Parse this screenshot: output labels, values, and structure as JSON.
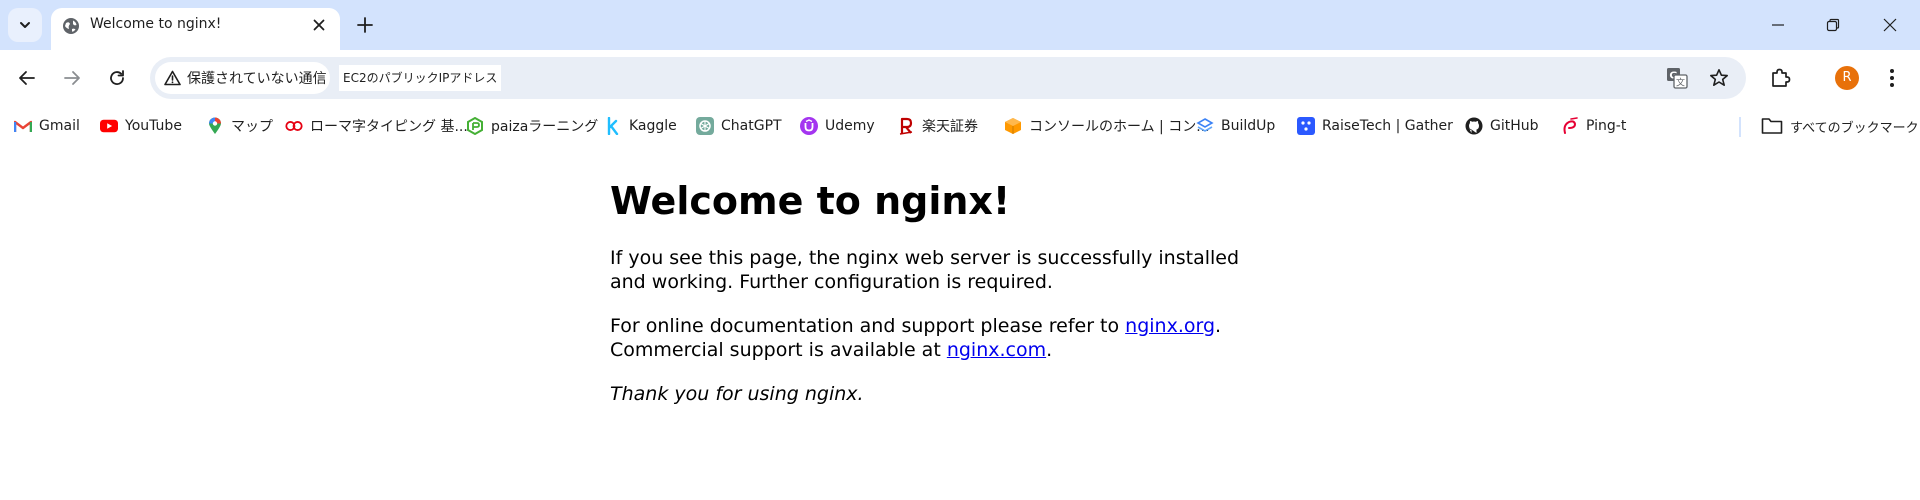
{
  "browser": {
    "tab": {
      "title": "Welcome to nginx!"
    },
    "address": {
      "security_label": "保護されていない通信",
      "url": "EC2のパブリックIPアドレス"
    },
    "avatar_letter": "R",
    "avatar_color": "#e8710a",
    "accent_color": "#d3e3fd"
  },
  "bookmarks": {
    "items": [
      {
        "label": "Gmail",
        "icon": "gmail-icon"
      },
      {
        "label": "YouTube",
        "icon": "youtube-icon"
      },
      {
        "label": "マップ",
        "icon": "maps-icon"
      },
      {
        "label": "ローマ字タイピング 基...",
        "icon": "typing-icon"
      },
      {
        "label": "paizaラーニング",
        "icon": "paiza-icon"
      },
      {
        "label": "Kaggle",
        "icon": "kaggle-icon"
      },
      {
        "label": "ChatGPT",
        "icon": "chatgpt-icon"
      },
      {
        "label": "Udemy",
        "icon": "udemy-icon"
      },
      {
        "label": "楽天証券",
        "icon": "rakuten-icon"
      },
      {
        "label": "コンソールのホーム | コン...",
        "icon": "aws-console-icon"
      },
      {
        "label": "BuildUp",
        "icon": "buildup-icon"
      },
      {
        "label": "RaiseTech | Gather",
        "icon": "raisetech-icon"
      },
      {
        "label": "GitHub",
        "icon": "github-icon"
      },
      {
        "label": "Ping-t",
        "icon": "pingt-icon"
      }
    ],
    "all_bookmarks_label": "すべてのブックマーク"
  },
  "page": {
    "heading": "Welcome to nginx!",
    "para1": "If you see this page, the nginx web server is successfully installed and working. Further configuration is required.",
    "para2_before_link1": "For online documentation and support please refer to ",
    "link1": "nginx.org",
    "para2_after_link1": ".",
    "para2_line2_before_link2": "Commercial support is available at ",
    "link2": "nginx.com",
    "para2_line2_after_link2": ".",
    "thanks": "Thank you for using nginx.",
    "link_color": "#0000ee"
  }
}
